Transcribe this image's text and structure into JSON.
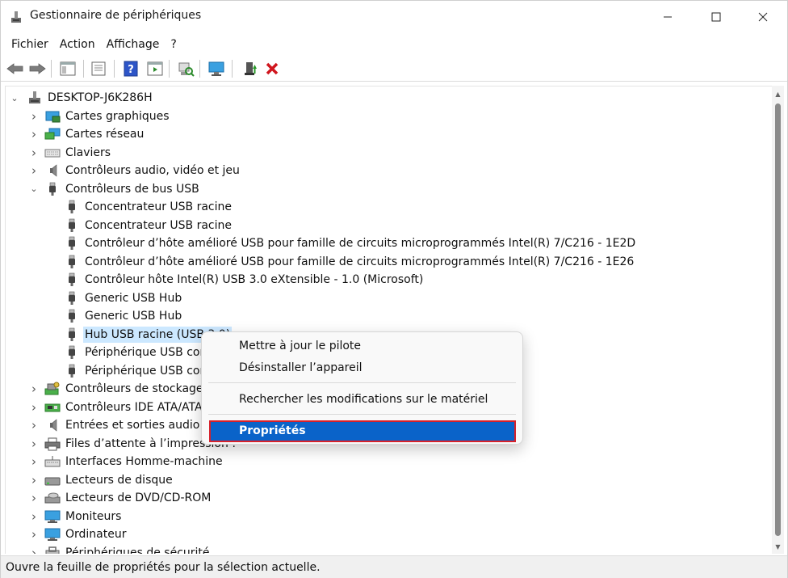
{
  "window": {
    "title": "Gestionnaire de périphériques"
  },
  "menubar": [
    "Fichier",
    "Action",
    "Affichage",
    "?"
  ],
  "tree": {
    "root": "DESKTOP-J6K286H",
    "items": [
      {
        "label": "Cartes graphiques",
        "level": 1,
        "expander": "collapsed",
        "icon": "display-adapter-icon"
      },
      {
        "label": "Cartes réseau",
        "level": 1,
        "expander": "collapsed",
        "icon": "network-adapter-icon"
      },
      {
        "label": "Claviers",
        "level": 1,
        "expander": "collapsed",
        "icon": "keyboard-icon"
      },
      {
        "label": "Contrôleurs audio, vidéo et jeu",
        "level": 1,
        "expander": "collapsed",
        "icon": "speaker-icon"
      },
      {
        "label": "Contrôleurs de bus USB",
        "level": 1,
        "expander": "expanded",
        "icon": "usb-icon"
      },
      {
        "label": "Concentrateur USB racine",
        "level": 2,
        "icon": "usb-icon"
      },
      {
        "label": "Concentrateur USB racine",
        "level": 2,
        "icon": "usb-icon"
      },
      {
        "label": "Contrôleur d’hôte amélioré USB pour famille de circuits microprogrammés Intel(R) 7/C216 - 1E2D",
        "level": 2,
        "icon": "usb-icon"
      },
      {
        "label": "Contrôleur d’hôte amélioré USB pour famille de circuits microprogrammés Intel(R) 7/C216 - 1E26",
        "level": 2,
        "icon": "usb-icon"
      },
      {
        "label": "Contrôleur hôte Intel(R) USB 3.0 eXtensible - 1.0 (Microsoft)",
        "level": 2,
        "icon": "usb-icon"
      },
      {
        "label": "Generic USB Hub",
        "level": 2,
        "icon": "usb-icon"
      },
      {
        "label": "Generic USB Hub",
        "level": 2,
        "icon": "usb-icon"
      },
      {
        "label": "Hub USB racine (USB 3.0)",
        "level": 2,
        "icon": "usb-icon",
        "selected": true
      },
      {
        "label": "Périphérique USB composite",
        "level": 2,
        "icon": "usb-icon"
      },
      {
        "label": "Périphérique USB composite",
        "level": 2,
        "icon": "usb-icon"
      },
      {
        "label": "Contrôleurs de stockage",
        "level": 1,
        "expander": "collapsed",
        "icon": "storage-controller-icon"
      },
      {
        "label": "Contrôleurs IDE ATA/ATAPI",
        "level": 1,
        "expander": "collapsed",
        "icon": "ide-controller-icon"
      },
      {
        "label": "Entrées et sorties audio",
        "level": 1,
        "expander": "collapsed",
        "icon": "speaker-icon"
      },
      {
        "label": "Files d’attente à l’impression :",
        "level": 1,
        "expander": "collapsed",
        "icon": "printer-icon"
      },
      {
        "label": "Interfaces Homme-machine",
        "level": 1,
        "expander": "collapsed",
        "icon": "hid-icon"
      },
      {
        "label": "Lecteurs de disque",
        "level": 1,
        "expander": "collapsed",
        "icon": "disk-drive-icon"
      },
      {
        "label": "Lecteurs de DVD/CD-ROM",
        "level": 1,
        "expander": "collapsed",
        "icon": "dvd-drive-icon"
      },
      {
        "label": "Moniteurs",
        "level": 1,
        "expander": "collapsed",
        "icon": "monitor-icon"
      },
      {
        "label": "Ordinateur",
        "level": 1,
        "expander": "collapsed",
        "icon": "monitor-icon"
      },
      {
        "label": "Périphériques de sécurité",
        "level": 1,
        "expander": "collapsed",
        "icon": "security-device-icon"
      }
    ]
  },
  "context_menu": {
    "update_driver": "Mettre à jour le pilote",
    "uninstall": "Désinstaller l’appareil",
    "scan_changes": "Rechercher les modifications sur le matériel",
    "properties": "Propriétés"
  },
  "statusbar": {
    "text": "Ouvre la feuille de propriétés pour la sélection actuelle."
  },
  "colors": {
    "selection": "#cce8ff",
    "menu_highlight": "#0a63c9",
    "highlight_border": "#d6212b"
  }
}
